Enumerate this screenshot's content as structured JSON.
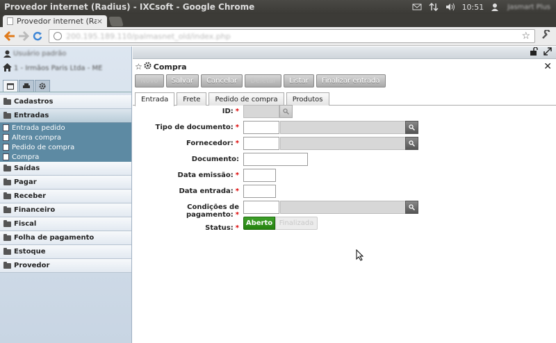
{
  "window": {
    "title": "Provedor internet (Radius) - IXCsoft - Google Chrome"
  },
  "tray": {
    "clock": "10:51",
    "user": "Jasmart Plus"
  },
  "browser": {
    "tab_label": "Provedor internet (Radius",
    "tab_close": "×",
    "url": "200.195.189.110/palmasnet_old/index.php"
  },
  "sidebar": {
    "user": "Usuário padrão",
    "company": "1 - Irmãos Paris Ltda - ME",
    "groups": [
      {
        "label": "Cadastros"
      },
      {
        "label": "Entradas"
      },
      {
        "label": "Saídas"
      },
      {
        "label": "Pagar"
      },
      {
        "label": "Receber"
      },
      {
        "label": "Financeiro"
      },
      {
        "label": "Fiscal"
      },
      {
        "label": "Folha de pagamento"
      },
      {
        "label": "Estoque"
      },
      {
        "label": "Provedor"
      }
    ],
    "entradas_items": [
      {
        "label": "Entrada pedido"
      },
      {
        "label": "Altera compra"
      },
      {
        "label": "Pedido de compra"
      },
      {
        "label": "Compra"
      }
    ]
  },
  "form": {
    "title": "Compra",
    "actions": {
      "novo": "Novo",
      "salvar": "Salvar",
      "cancelar": "Cancelar",
      "deletar": "Deletar",
      "listar": "Listar",
      "finalizar": "Finalizar entrada"
    },
    "tabs": {
      "entrada": "Entrada",
      "frete": "Frete",
      "pedido": "Pedido de compra",
      "produtos": "Produtos"
    },
    "fields": {
      "id": "ID:",
      "tipo_documento": "Tipo de documento:",
      "fornecedor": "Fornecedor:",
      "documento": "Documento:",
      "data_emissao": "Data emissão:",
      "data_entrada": "Data entrada:",
      "condicoes": "Condições de pagamento:",
      "status": "Status:"
    },
    "required_mark": "*",
    "status_options": {
      "aberto": "Aberto",
      "finalizada": "Finalizada"
    }
  }
}
